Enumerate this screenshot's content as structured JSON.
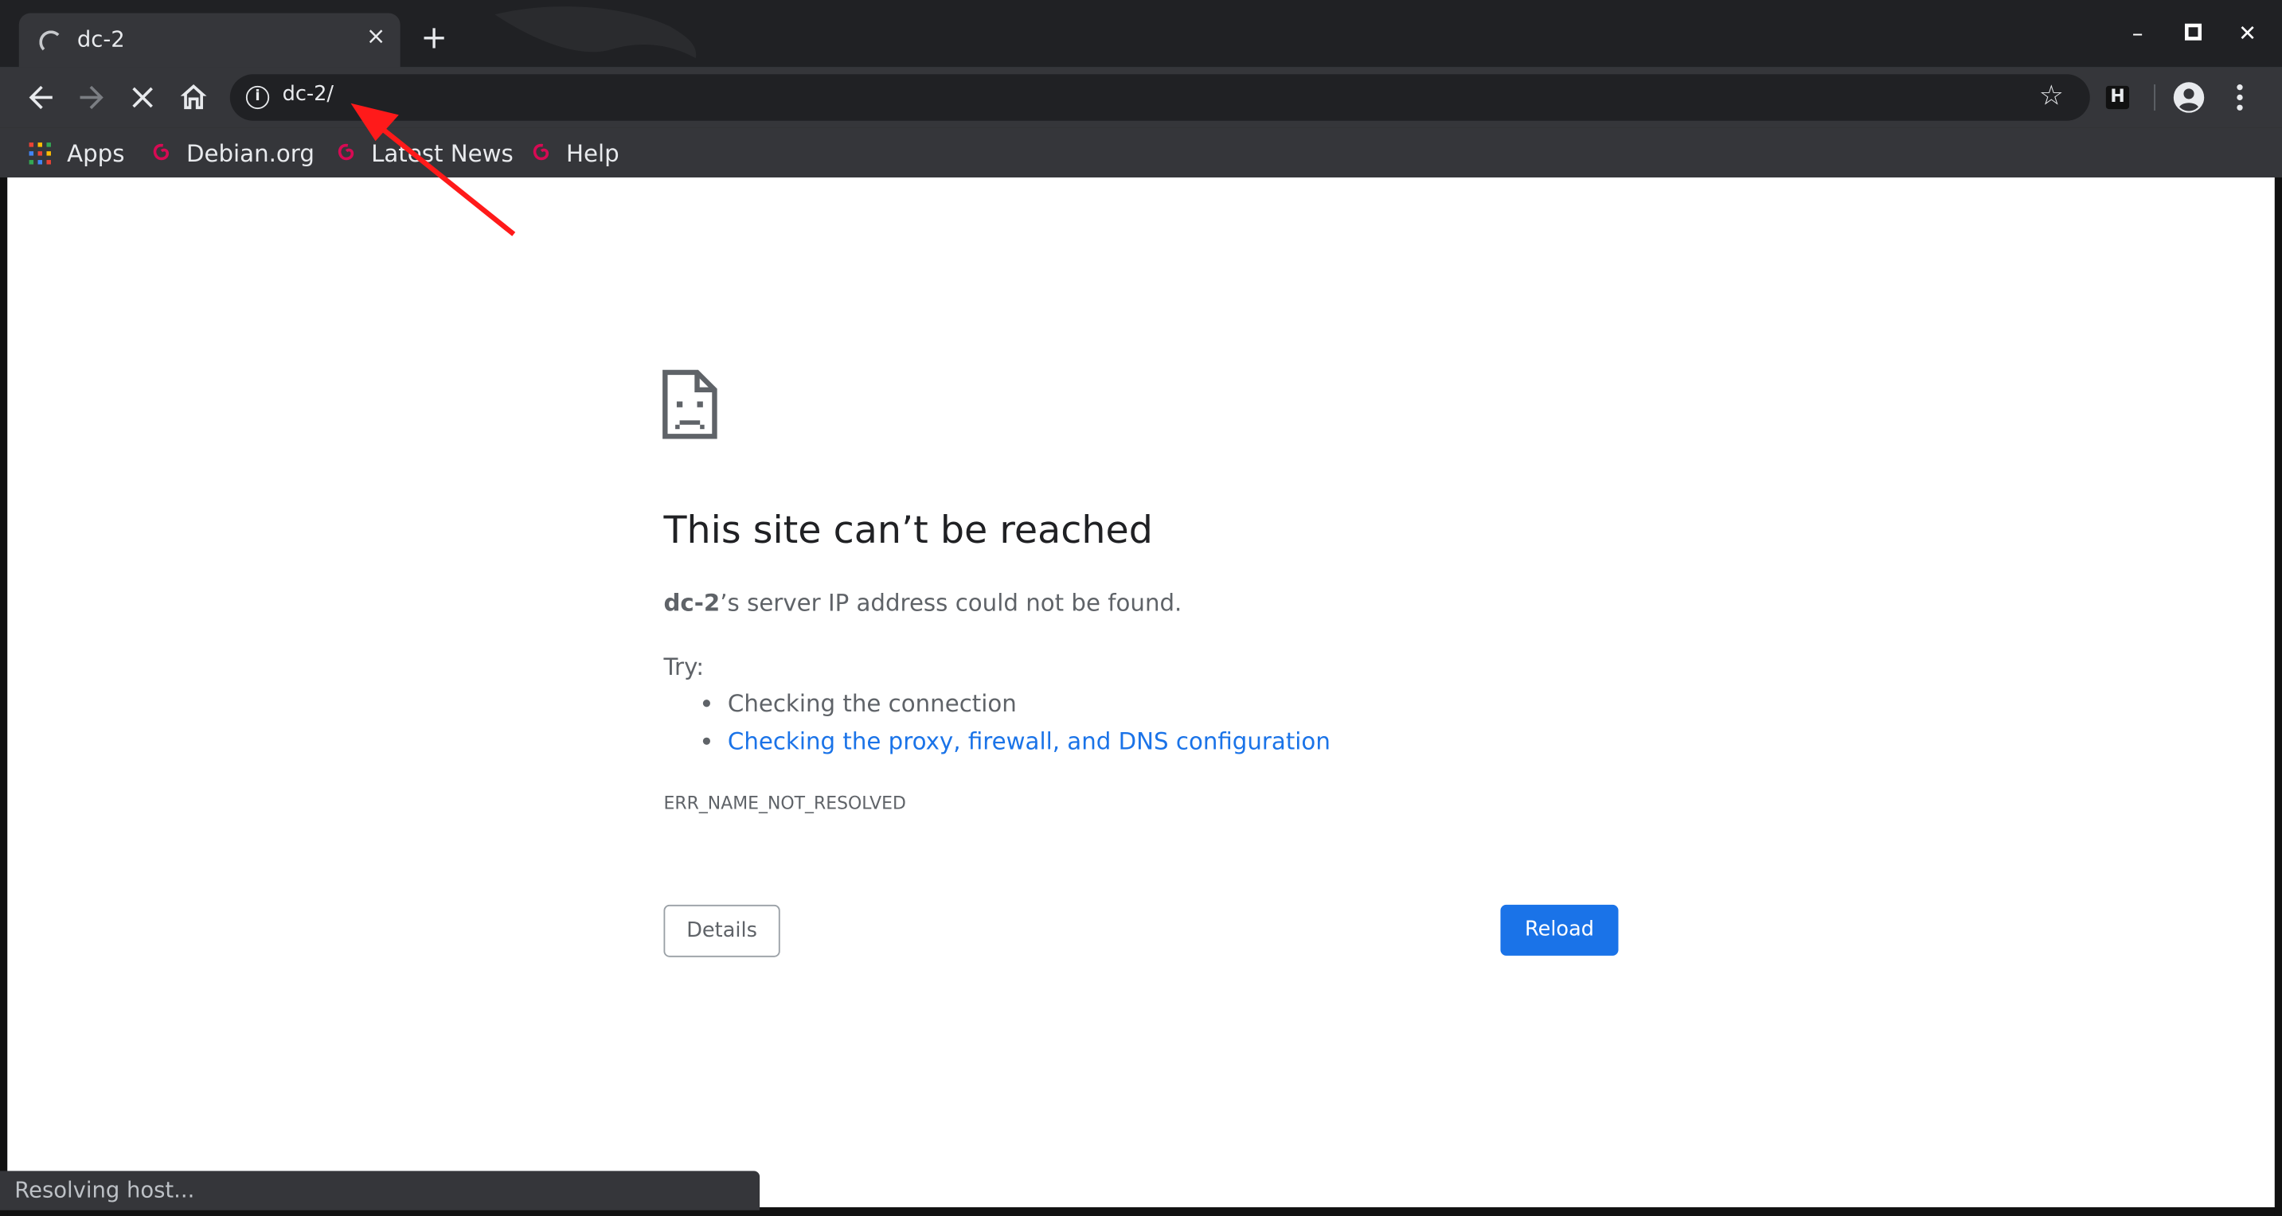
{
  "tab": {
    "title": "dc-2",
    "close_glyph": "×",
    "new_tab_glyph": "+",
    "loading_icon": "spinner-icon"
  },
  "window_controls": {
    "minimize_glyph": "–",
    "maximize_glyph": "□",
    "close_glyph": "✕"
  },
  "toolbar": {
    "url": "dc-2/",
    "info_glyph": "i",
    "bookmark_star_glyph": "☆",
    "extension_glyph": "H",
    "icons": [
      "back-arrow-icon",
      "forward-arrow-icon",
      "stop-icon",
      "home-icon",
      "info-icon",
      "star-icon",
      "extension-icon",
      "profile-icon",
      "menu-icon"
    ]
  },
  "bookmarks": [
    {
      "label": "Apps",
      "icon": "apps-grid-icon"
    },
    {
      "label": "Debian.org",
      "icon": "debian-swirl-icon"
    },
    {
      "label": "Latest News",
      "icon": "debian-swirl-icon"
    },
    {
      "label": "Help",
      "icon": "debian-swirl-icon"
    }
  ],
  "error": {
    "icon": "sad-page-icon",
    "heading": "This site can’t be reached",
    "host": "dc-2",
    "description_rest": "’s server IP address could not be found.",
    "try_label": "Try:",
    "suggestions": [
      {
        "text": "Checking the connection",
        "link": false
      },
      {
        "text": "Checking the proxy, firewall, and DNS configuration",
        "link": true
      }
    ],
    "code": "ERR_NAME_NOT_RESOLVED",
    "details_label": "Details",
    "reload_label": "Reload"
  },
  "status_bar": {
    "text": "Resolving host..."
  },
  "colors": {
    "frame": "#202124",
    "toolbar": "#35363a",
    "link": "#1a73e8",
    "annotation_arrow": "#ff0000"
  }
}
